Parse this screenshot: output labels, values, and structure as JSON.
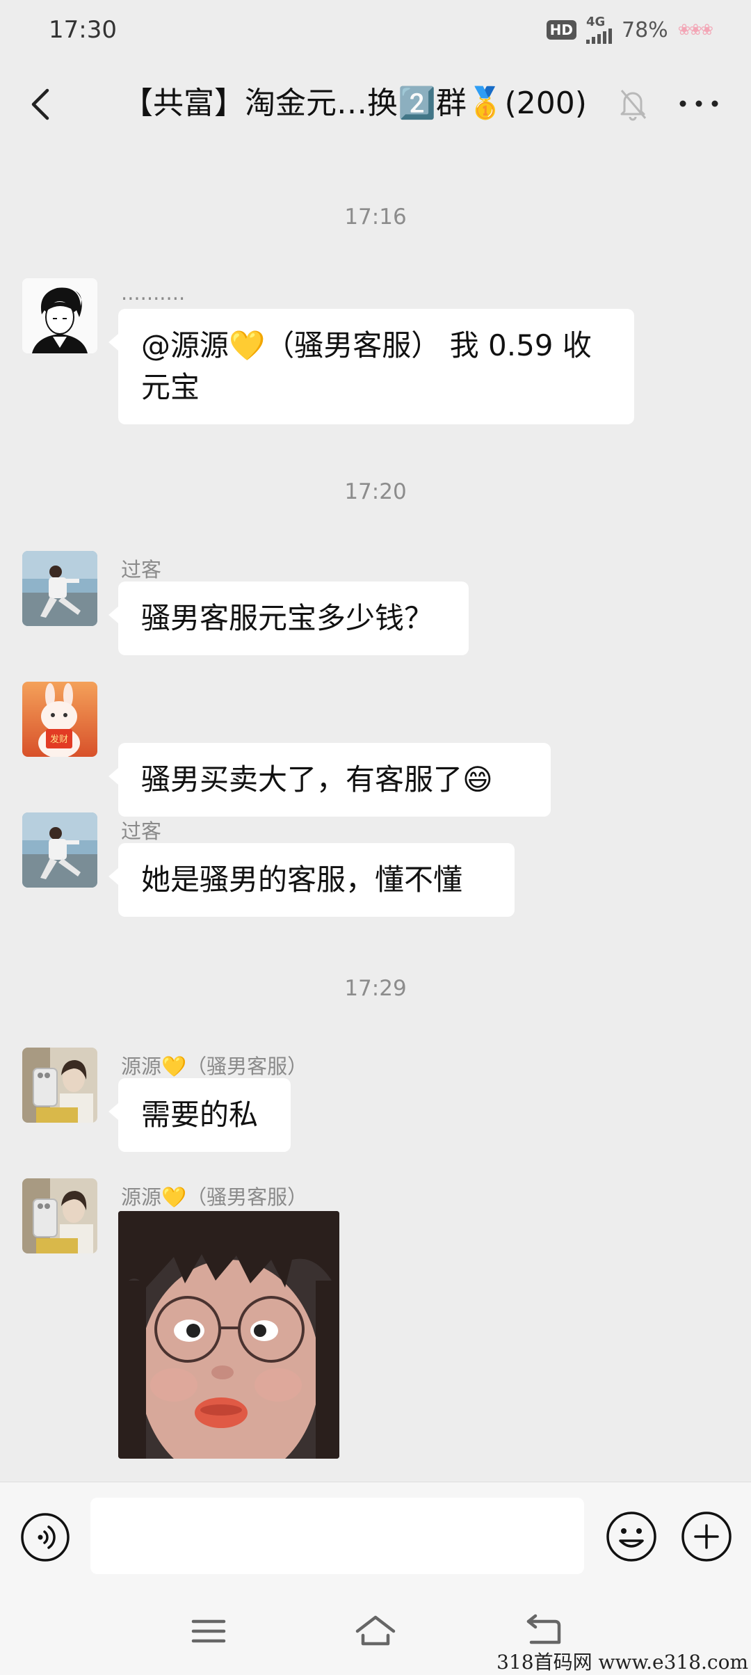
{
  "status_bar": {
    "time": "17:30",
    "hd": "HD",
    "network": "4G",
    "battery": "78%",
    "decoration": "❀❀❀"
  },
  "header": {
    "title": "【共富】淘金元…换2️⃣群🥇(200)"
  },
  "messages": [
    {
      "type": "timestamp",
      "text": "17:16"
    },
    {
      "type": "text",
      "sender": "..........",
      "text": "@源源💛（骚男客服） 我 0.59 收元宝"
    },
    {
      "type": "timestamp",
      "text": "17:20"
    },
    {
      "type": "text",
      "sender": "过客",
      "text": "骚男客服元宝多少钱？"
    },
    {
      "type": "text",
      "sender": "",
      "text": "骚男买卖大了，有客服了😄",
      "avatar_badge": "发财"
    },
    {
      "type": "text",
      "sender": "过客",
      "text": "她是骚男的客服，懂不懂"
    },
    {
      "type": "timestamp",
      "text": "17:29"
    },
    {
      "type": "text",
      "sender": "源源💛（骚男客服）",
      "text": "需要的私"
    },
    {
      "type": "sticker",
      "sender": "源源💛（骚男客服）"
    }
  ],
  "input": {
    "placeholder": ""
  },
  "icons": {
    "back": "chevron-left-icon",
    "mute": "bell-off-icon",
    "more": "more-horizontal-icon",
    "voice": "voice-icon",
    "emoji": "emoji-icon",
    "plus": "plus-circle-icon",
    "menu": "menu-icon",
    "home": "home-icon",
    "back_nav": "back-arrow-icon"
  },
  "colors": {
    "background": "#ededed",
    "bubble": "#ffffff",
    "input_bar": "#f6f6f6"
  },
  "watermark": "318首码网 www.e318.com"
}
